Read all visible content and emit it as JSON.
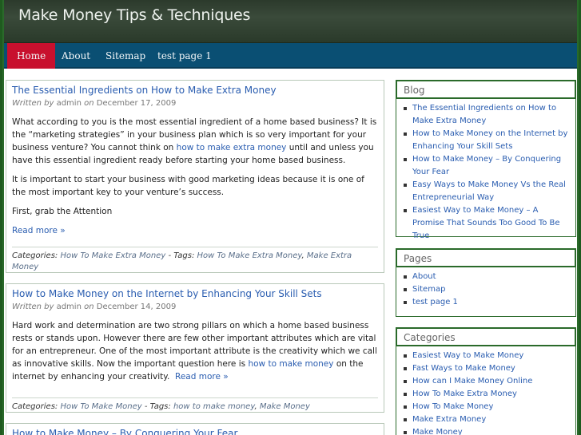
{
  "site": {
    "title": "Make Money Tips & Techniques"
  },
  "nav": [
    {
      "label": "Home"
    },
    {
      "label": "About"
    },
    {
      "label": "Sitemap"
    },
    {
      "label": "test page 1"
    }
  ],
  "posts": [
    {
      "title": "The Essential Ingredients on How to Make Extra Money",
      "meta": {
        "written_by": "Written by",
        "author": "admin",
        "on": "on",
        "date": "December 17, 2009"
      },
      "p1_a": "What according to you is the most essential ingredient of a home based business? It is the “marketing strategies” in your business plan which is so very important for your business venture? You cannot think on ",
      "p1_link": "how to make extra money",
      "p1_b": " until and unless you have this essential ingredient ready before starting your home based business.",
      "p2": "It is important to start your business with good marketing ideas because it is one of the most important key to your venture’s success.",
      "p3": "First, grab the Attention",
      "more": "Read more »",
      "categories_label": "Categories:",
      "category": "How To Make Extra Money",
      "tags_label": "- Tags:",
      "tags": [
        "How To Make Extra Money",
        "Make Extra Money"
      ]
    },
    {
      "title": "How to Make Money on the Internet by Enhancing Your Skill Sets",
      "meta": {
        "written_by": "Written by",
        "author": "admin",
        "on": "on",
        "date": "December 14, 2009"
      },
      "p1_a": "Hard work and determination are two strong pillars on which a home based business rests or stands upon. However there are few other important attributes which are vital for an entrepreneur. One of the most important attribute is the creativity which we call as innovative skills. Now the important question here is ",
      "p1_link": "how to make money",
      "p1_b": " on the internet by enhancing your creativity.",
      "more": "Read more »",
      "categories_label": "Categories:",
      "category": "How To Make Money",
      "tags_label": "- Tags:",
      "tags": [
        "how to make money",
        "Make Money"
      ]
    },
    {
      "title": "How to Make Money – By Conquering Your Fear"
    }
  ],
  "sidebar": {
    "blog": {
      "title": "Blog",
      "items": [
        "The Essential Ingredients on How to Make Extra Money",
        "How to Make Money on the Internet by Enhancing Your Skill Sets",
        "How to Make Money – By Conquering Your Fear",
        "Easy Ways to Make Money Vs the Real Entrepreneurial Way",
        "Easiest Way to Make Money – A Promise That Sounds Too Good To Be True"
      ]
    },
    "pages": {
      "title": "Pages",
      "items": [
        "About",
        "Sitemap",
        "test page 1"
      ]
    },
    "categories": {
      "title": "Categories",
      "items": [
        "Easiest Way to Make Money",
        "Fast Ways to Make Money",
        "How can I Make Money Online",
        "How To Make Extra Money",
        "How To Make Money",
        "Make Extra Money",
        "Make Money"
      ]
    }
  }
}
